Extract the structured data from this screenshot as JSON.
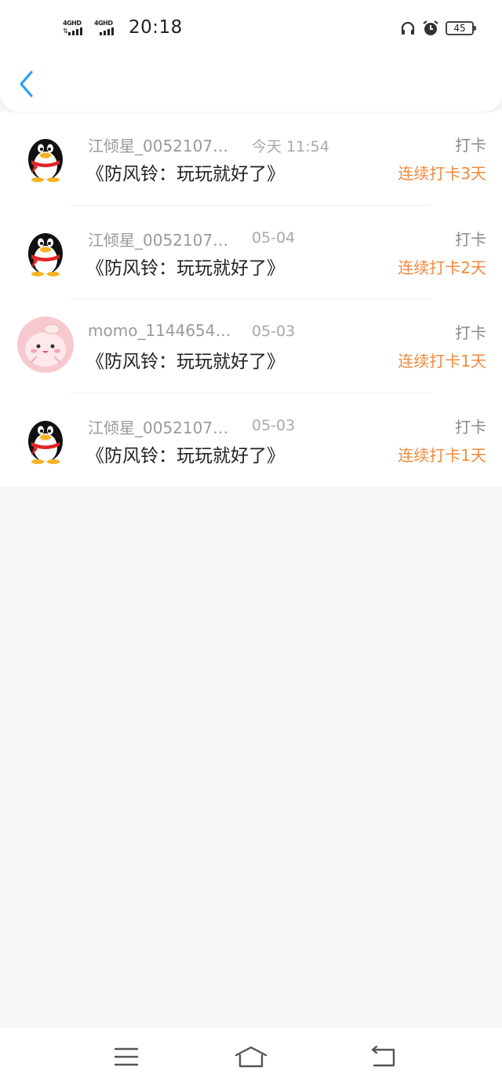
{
  "status_bar": {
    "network_1": "4GHD",
    "network_2": "4GHD",
    "time": "20:18",
    "battery": "45",
    "icons": [
      "headphones-icon",
      "alarm-clock-icon",
      "battery-icon",
      "signal-bars-icon"
    ]
  },
  "header": {
    "back_icon": "chevron-left-icon",
    "accent_color": "#2a9ef0"
  },
  "records": [
    {
      "avatar": "qq-penguin-avatar",
      "user": "江倾星_0052107…",
      "date": "今天 11:54",
      "title": "《防风铃：玩玩就好了》",
      "tag": "打卡",
      "streak": "连续打卡3天"
    },
    {
      "avatar": "qq-penguin-avatar",
      "user": "江倾星_0052107…",
      "date": "05-04",
      "title": "《防风铃：玩玩就好了》",
      "tag": "打卡",
      "streak": "连续打卡2天"
    },
    {
      "avatar": "pink-cartoon-avatar",
      "user": "momo_1144654…",
      "date": "05-03",
      "title": "《防风铃：玩玩就好了》",
      "tag": "打卡",
      "streak": "连续打卡1天"
    },
    {
      "avatar": "qq-penguin-avatar",
      "user": "江倾星_0052107…",
      "date": "05-03",
      "title": "《防风铃：玩玩就好了》",
      "tag": "打卡",
      "streak": "连续打卡1天"
    }
  ],
  "colors": {
    "streak": "#f08a3c",
    "background": "#f7f6f7"
  },
  "nav_bar": {
    "icons": [
      "menu-icon",
      "home-icon",
      "back-icon"
    ]
  }
}
